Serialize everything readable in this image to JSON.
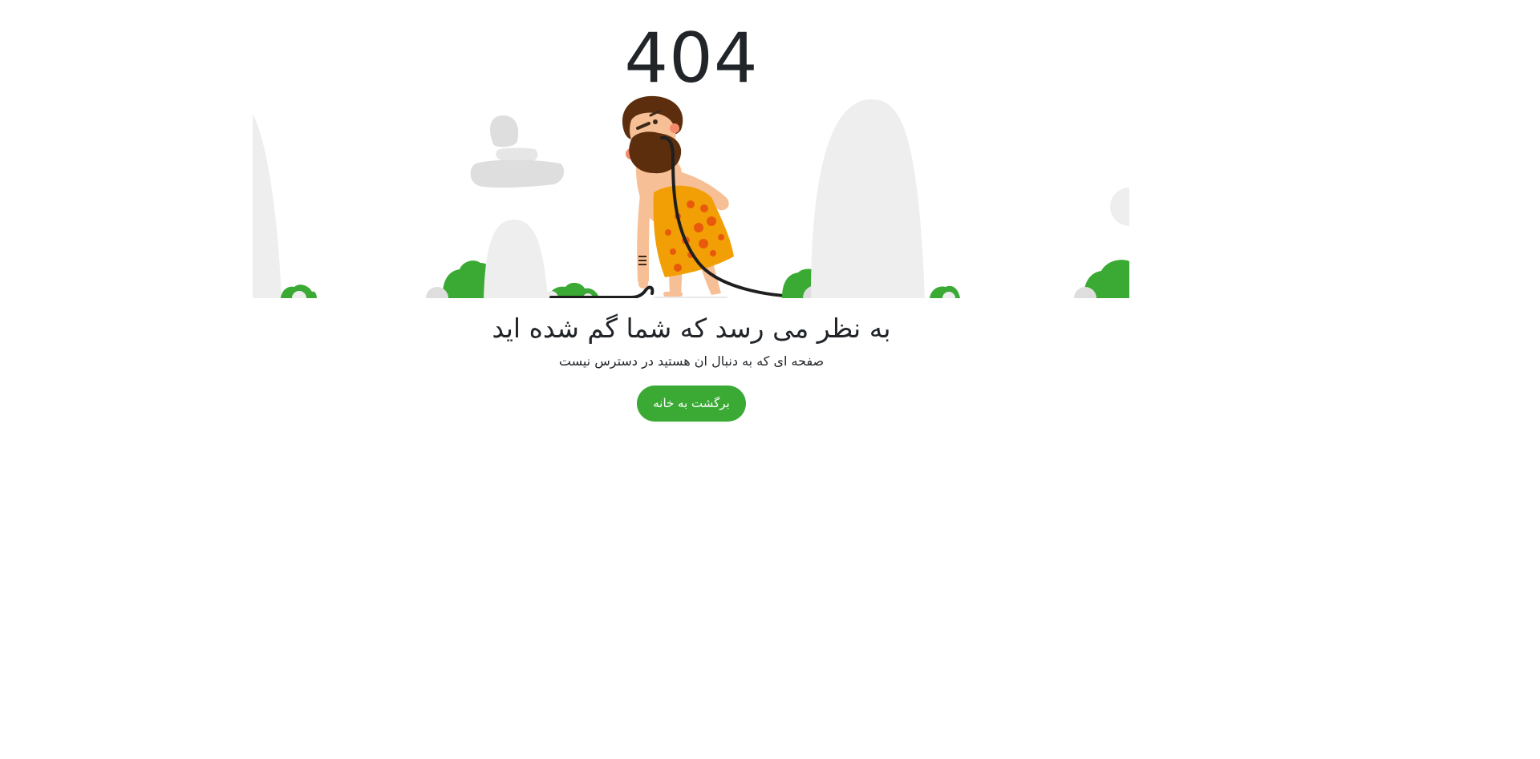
{
  "error_code": "404",
  "heading": "به نظر می رسد که شما گم شده اید",
  "subtext": "صفحه ای که به دنبال ان هستید در دسترس نیست",
  "home_button_label": "برگشت به خانه",
  "colors": {
    "accent": "#3aaa35",
    "text": "#212529",
    "rock": "#eeeeee",
    "rock_dark": "#dedede",
    "bush": "#3aaa35",
    "skin": "#f7bf95",
    "hair": "#5c2e0e",
    "outfit": "#f29f05"
  }
}
